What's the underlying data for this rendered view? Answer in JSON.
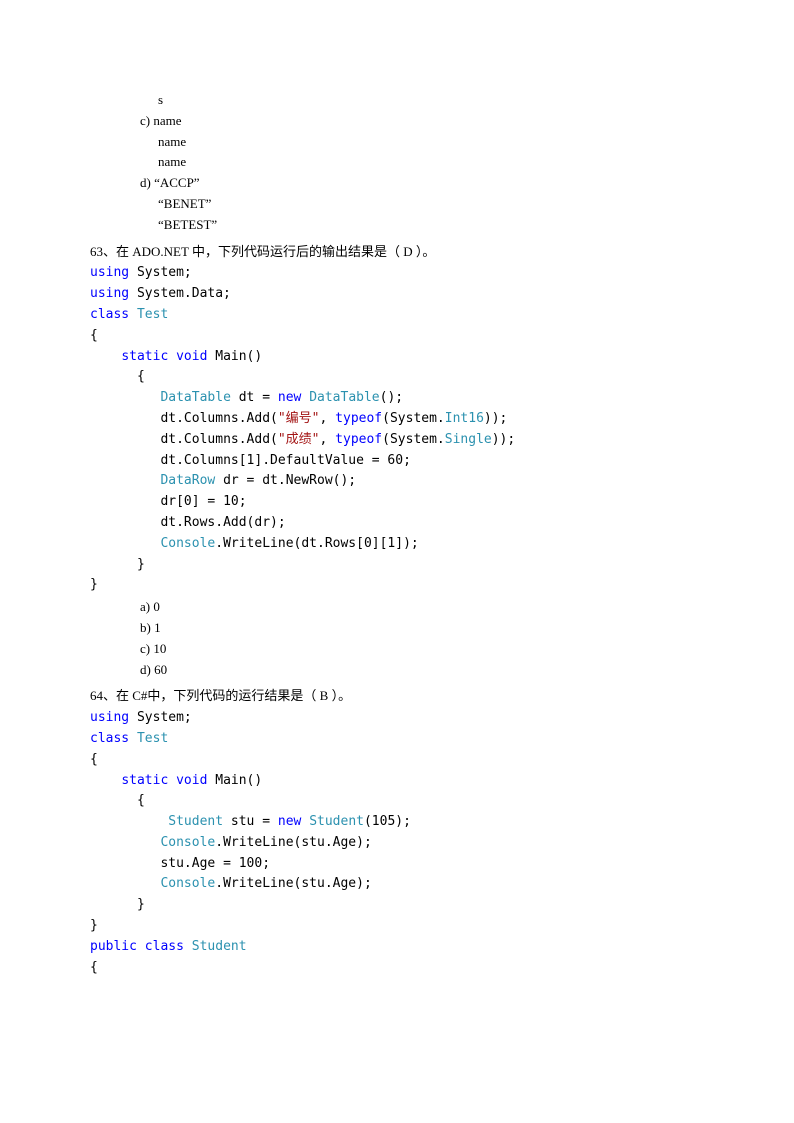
{
  "top": {
    "b_line3": "s",
    "c_line1": "c) name",
    "c_line2": "name",
    "c_line3": "name",
    "d_line1": "d) “ACCP”",
    "d_line2": "“BENET”",
    "d_line3": "“BETEST”"
  },
  "c": {
    "using": "using",
    "class": "class",
    "static": "static",
    "void": "void",
    "new": "new",
    "typeof": "typeof",
    "public": "public",
    "Test": "Test",
    "DataTable": "DataTable",
    "DataRow": "DataRow",
    "Console": "Console",
    "Int16": "Int16",
    "Single": "Single",
    "Student": "Student",
    "Main": "Main()",
    "lbrace": "{",
    "rbrace": "}",
    "paren": "();"
  },
  "q63": {
    "text": "63、在 ADO.NET 中，下列代码运行后的输出结果是（  D  ）。",
    "sys1": "System;",
    "sys2": "System.Data;",
    "l1": "dt =",
    "l2a": "dt.Columns.Add(",
    "l2b": "\"编号\"",
    "l2c": ",",
    "l2d": "(System.",
    "l2e": "));",
    "l3a": "dt.Columns.Add(",
    "l3b": "\"成绩\"",
    "l3c": ",",
    "l3d": "(System.",
    "l3e": "));",
    "l4": "dt.Columns[1].DefaultValue = 60;",
    "l5": "dr = dt.NewRow();",
    "l6": "dr[0] = 10;",
    "l7": "dt.Rows.Add(dr);",
    "l8": ".WriteLine(dt.Rows[0][1]);",
    "oa": "a) 0",
    "ob": "b) 1",
    "oc": "c) 10",
    "od": "d) 60"
  },
  "q64": {
    "text": "64、在 C#中，下列代码的运行结果是（  B  ）。",
    "sys1": "System;",
    "l1": "stu =",
    "l1b": "(105);",
    "l2": ".WriteLine(stu.Age);",
    "l3": "stu.Age = 100;",
    "l4": ".WriteLine(stu.Age);"
  }
}
